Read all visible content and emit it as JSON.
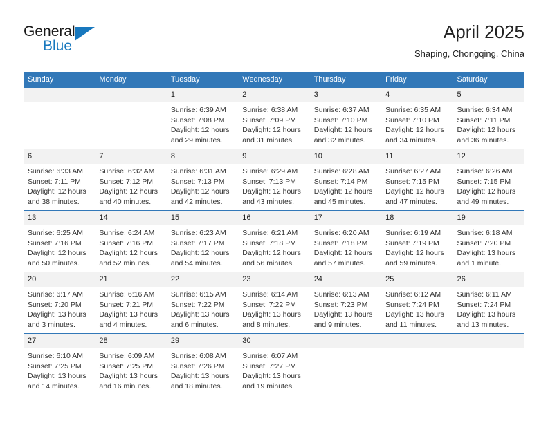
{
  "logo": {
    "word_top": "General",
    "word_bottom": "Blue",
    "accent_color": "#1878be"
  },
  "header": {
    "title": "April 2025",
    "subtitle": "Shaping, Chongqing, China"
  },
  "theme": {
    "header_bg": "#3278b8",
    "daynum_bg": "#f2f2f2",
    "divider": "#3278b8"
  },
  "weekdays": [
    "Sunday",
    "Monday",
    "Tuesday",
    "Wednesday",
    "Thursday",
    "Friday",
    "Saturday"
  ],
  "weeks": [
    [
      {
        "day": "",
        "sunrise": "",
        "sunset": "",
        "daylight1": "",
        "daylight2": ""
      },
      {
        "day": "",
        "sunrise": "",
        "sunset": "",
        "daylight1": "",
        "daylight2": ""
      },
      {
        "day": "1",
        "sunrise": "Sunrise: 6:39 AM",
        "sunset": "Sunset: 7:08 PM",
        "daylight1": "Daylight: 12 hours",
        "daylight2": "and 29 minutes."
      },
      {
        "day": "2",
        "sunrise": "Sunrise: 6:38 AM",
        "sunset": "Sunset: 7:09 PM",
        "daylight1": "Daylight: 12 hours",
        "daylight2": "and 31 minutes."
      },
      {
        "day": "3",
        "sunrise": "Sunrise: 6:37 AM",
        "sunset": "Sunset: 7:10 PM",
        "daylight1": "Daylight: 12 hours",
        "daylight2": "and 32 minutes."
      },
      {
        "day": "4",
        "sunrise": "Sunrise: 6:35 AM",
        "sunset": "Sunset: 7:10 PM",
        "daylight1": "Daylight: 12 hours",
        "daylight2": "and 34 minutes."
      },
      {
        "day": "5",
        "sunrise": "Sunrise: 6:34 AM",
        "sunset": "Sunset: 7:11 PM",
        "daylight1": "Daylight: 12 hours",
        "daylight2": "and 36 minutes."
      }
    ],
    [
      {
        "day": "6",
        "sunrise": "Sunrise: 6:33 AM",
        "sunset": "Sunset: 7:11 PM",
        "daylight1": "Daylight: 12 hours",
        "daylight2": "and 38 minutes."
      },
      {
        "day": "7",
        "sunrise": "Sunrise: 6:32 AM",
        "sunset": "Sunset: 7:12 PM",
        "daylight1": "Daylight: 12 hours",
        "daylight2": "and 40 minutes."
      },
      {
        "day": "8",
        "sunrise": "Sunrise: 6:31 AM",
        "sunset": "Sunset: 7:13 PM",
        "daylight1": "Daylight: 12 hours",
        "daylight2": "and 42 minutes."
      },
      {
        "day": "9",
        "sunrise": "Sunrise: 6:29 AM",
        "sunset": "Sunset: 7:13 PM",
        "daylight1": "Daylight: 12 hours",
        "daylight2": "and 43 minutes."
      },
      {
        "day": "10",
        "sunrise": "Sunrise: 6:28 AM",
        "sunset": "Sunset: 7:14 PM",
        "daylight1": "Daylight: 12 hours",
        "daylight2": "and 45 minutes."
      },
      {
        "day": "11",
        "sunrise": "Sunrise: 6:27 AM",
        "sunset": "Sunset: 7:15 PM",
        "daylight1": "Daylight: 12 hours",
        "daylight2": "and 47 minutes."
      },
      {
        "day": "12",
        "sunrise": "Sunrise: 6:26 AM",
        "sunset": "Sunset: 7:15 PM",
        "daylight1": "Daylight: 12 hours",
        "daylight2": "and 49 minutes."
      }
    ],
    [
      {
        "day": "13",
        "sunrise": "Sunrise: 6:25 AM",
        "sunset": "Sunset: 7:16 PM",
        "daylight1": "Daylight: 12 hours",
        "daylight2": "and 50 minutes."
      },
      {
        "day": "14",
        "sunrise": "Sunrise: 6:24 AM",
        "sunset": "Sunset: 7:16 PM",
        "daylight1": "Daylight: 12 hours",
        "daylight2": "and 52 minutes."
      },
      {
        "day": "15",
        "sunrise": "Sunrise: 6:23 AM",
        "sunset": "Sunset: 7:17 PM",
        "daylight1": "Daylight: 12 hours",
        "daylight2": "and 54 minutes."
      },
      {
        "day": "16",
        "sunrise": "Sunrise: 6:21 AM",
        "sunset": "Sunset: 7:18 PM",
        "daylight1": "Daylight: 12 hours",
        "daylight2": "and 56 minutes."
      },
      {
        "day": "17",
        "sunrise": "Sunrise: 6:20 AM",
        "sunset": "Sunset: 7:18 PM",
        "daylight1": "Daylight: 12 hours",
        "daylight2": "and 57 minutes."
      },
      {
        "day": "18",
        "sunrise": "Sunrise: 6:19 AM",
        "sunset": "Sunset: 7:19 PM",
        "daylight1": "Daylight: 12 hours",
        "daylight2": "and 59 minutes."
      },
      {
        "day": "19",
        "sunrise": "Sunrise: 6:18 AM",
        "sunset": "Sunset: 7:20 PM",
        "daylight1": "Daylight: 13 hours",
        "daylight2": "and 1 minute."
      }
    ],
    [
      {
        "day": "20",
        "sunrise": "Sunrise: 6:17 AM",
        "sunset": "Sunset: 7:20 PM",
        "daylight1": "Daylight: 13 hours",
        "daylight2": "and 3 minutes."
      },
      {
        "day": "21",
        "sunrise": "Sunrise: 6:16 AM",
        "sunset": "Sunset: 7:21 PM",
        "daylight1": "Daylight: 13 hours",
        "daylight2": "and 4 minutes."
      },
      {
        "day": "22",
        "sunrise": "Sunrise: 6:15 AM",
        "sunset": "Sunset: 7:22 PM",
        "daylight1": "Daylight: 13 hours",
        "daylight2": "and 6 minutes."
      },
      {
        "day": "23",
        "sunrise": "Sunrise: 6:14 AM",
        "sunset": "Sunset: 7:22 PM",
        "daylight1": "Daylight: 13 hours",
        "daylight2": "and 8 minutes."
      },
      {
        "day": "24",
        "sunrise": "Sunrise: 6:13 AM",
        "sunset": "Sunset: 7:23 PM",
        "daylight1": "Daylight: 13 hours",
        "daylight2": "and 9 minutes."
      },
      {
        "day": "25",
        "sunrise": "Sunrise: 6:12 AM",
        "sunset": "Sunset: 7:24 PM",
        "daylight1": "Daylight: 13 hours",
        "daylight2": "and 11 minutes."
      },
      {
        "day": "26",
        "sunrise": "Sunrise: 6:11 AM",
        "sunset": "Sunset: 7:24 PM",
        "daylight1": "Daylight: 13 hours",
        "daylight2": "and 13 minutes."
      }
    ],
    [
      {
        "day": "27",
        "sunrise": "Sunrise: 6:10 AM",
        "sunset": "Sunset: 7:25 PM",
        "daylight1": "Daylight: 13 hours",
        "daylight2": "and 14 minutes."
      },
      {
        "day": "28",
        "sunrise": "Sunrise: 6:09 AM",
        "sunset": "Sunset: 7:25 PM",
        "daylight1": "Daylight: 13 hours",
        "daylight2": "and 16 minutes."
      },
      {
        "day": "29",
        "sunrise": "Sunrise: 6:08 AM",
        "sunset": "Sunset: 7:26 PM",
        "daylight1": "Daylight: 13 hours",
        "daylight2": "and 18 minutes."
      },
      {
        "day": "30",
        "sunrise": "Sunrise: 6:07 AM",
        "sunset": "Sunset: 7:27 PM",
        "daylight1": "Daylight: 13 hours",
        "daylight2": "and 19 minutes."
      },
      {
        "day": "",
        "sunrise": "",
        "sunset": "",
        "daylight1": "",
        "daylight2": ""
      },
      {
        "day": "",
        "sunrise": "",
        "sunset": "",
        "daylight1": "",
        "daylight2": ""
      },
      {
        "day": "",
        "sunrise": "",
        "sunset": "",
        "daylight1": "",
        "daylight2": ""
      }
    ]
  ]
}
